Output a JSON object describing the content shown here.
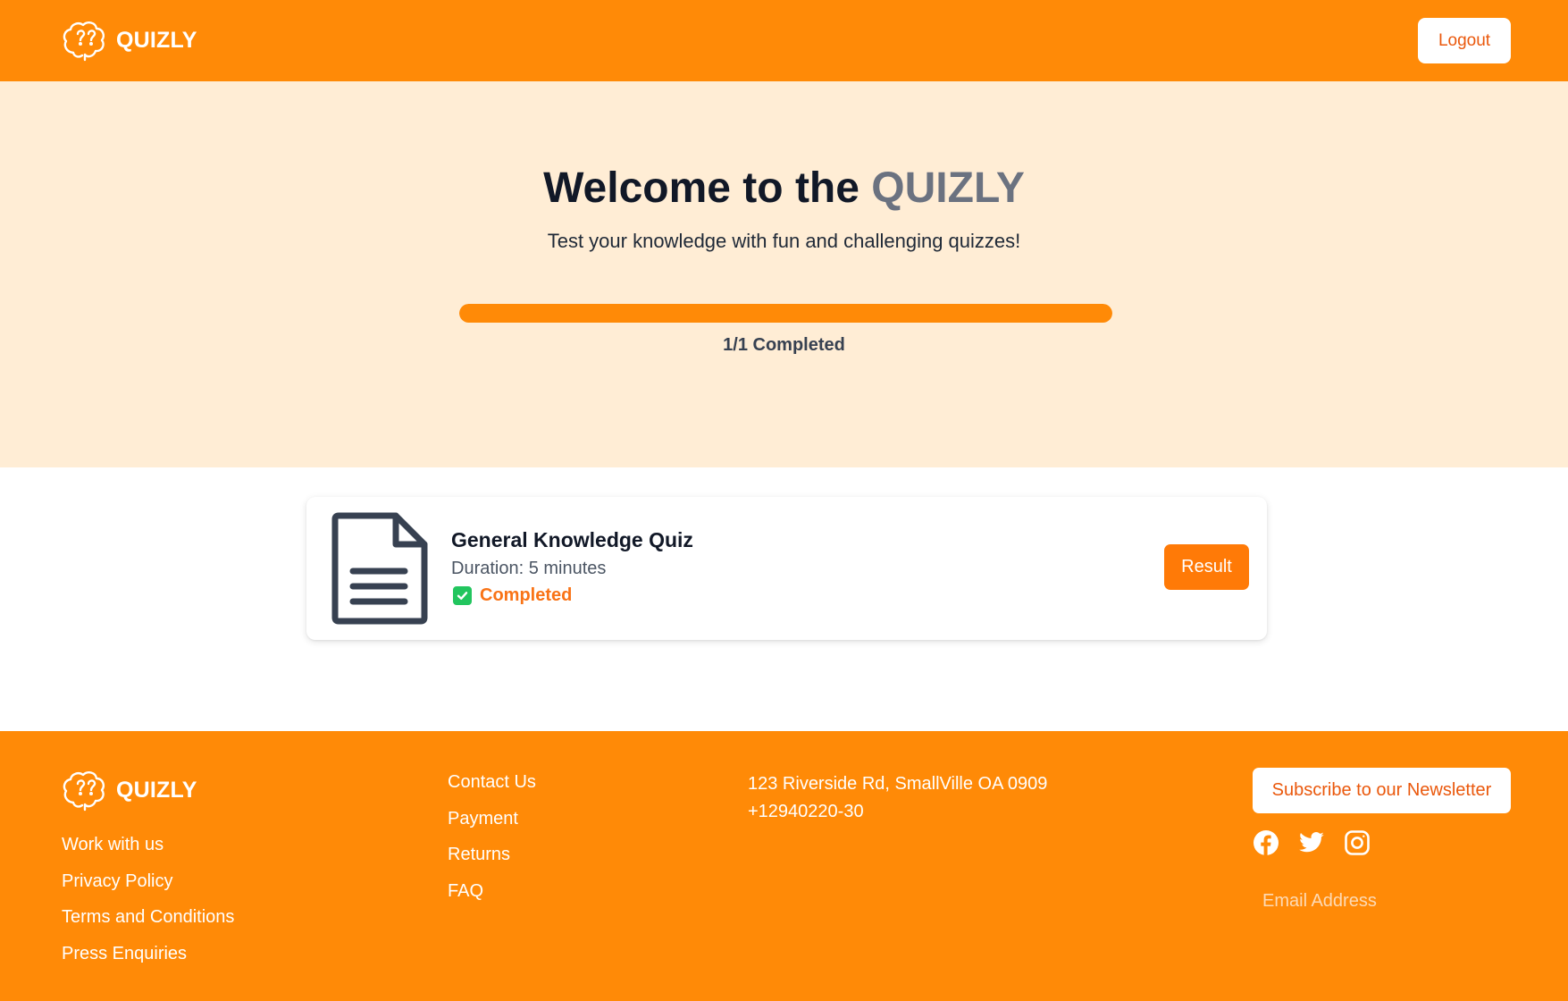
{
  "header": {
    "brand": "QUIZLY",
    "logout_label": "Logout"
  },
  "hero": {
    "title_prefix": "Welcome to the ",
    "title_accent": "QUIZLY",
    "subtitle": "Test your knowledge with fun and challenging quizzes!",
    "progress_fraction": 1.0,
    "progress_label": "1/1 Completed"
  },
  "quiz": {
    "title": "General Knowledge Quiz",
    "duration": "Duration: 5 minutes",
    "status": "Completed",
    "result_label": "Result"
  },
  "footer": {
    "brand": "QUIZLY",
    "col1": [
      "Work with us",
      "Privacy Policy",
      "Terms and Conditions",
      "Press Enquiries"
    ],
    "col2": [
      "Contact Us",
      "Payment",
      "Returns",
      "FAQ"
    ],
    "address_line1": "123 Riverside Rd, SmallVille OA 0909",
    "address_line2": "+12940220-30",
    "newsletter_label": "Subscribe to our Newsletter",
    "email_placeholder": "Email Address",
    "socials": [
      "facebook-icon",
      "twitter-icon",
      "instagram-icon"
    ]
  },
  "colors": {
    "brand_orange": "#ff8a07",
    "hero_bg": "#ffedd5",
    "accent_text": "#ea580c",
    "success": "#22c55e"
  }
}
